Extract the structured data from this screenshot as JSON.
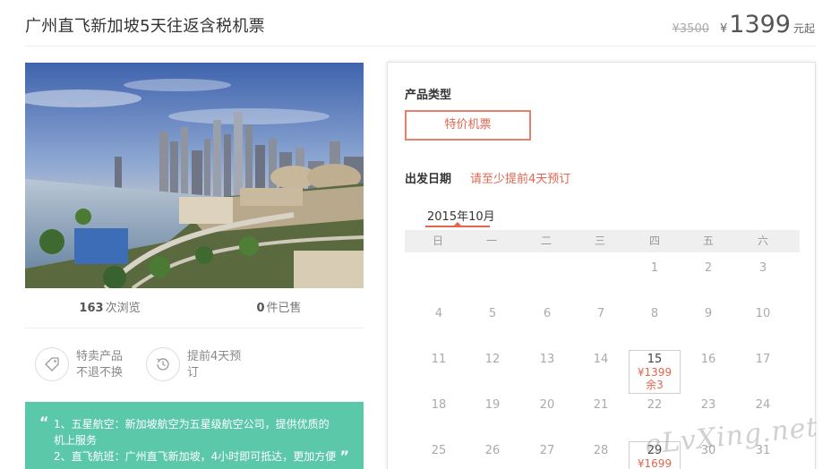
{
  "title": "广州直飞新加坡5天往返含税机票",
  "price": {
    "original": "¥3500",
    "currency": "¥",
    "current": "1399",
    "suffix": "元起"
  },
  "stats": {
    "views_count": "163",
    "views_label": "次浏览",
    "sold_count": "0",
    "sold_label": "件已售"
  },
  "features": [
    {
      "line1": "特卖产品",
      "line2": "不退不换",
      "icon": "price-tag-icon"
    },
    {
      "line1": "提前4天预",
      "line2": "订",
      "icon": "clock-icon"
    }
  ],
  "description": {
    "line1": "1、五星航空：新加坡航空为五星级航空公司，提供优质的",
    "line2": "机上服务",
    "line3": "2、直飞航班：广州直飞新加坡，4小时即可抵达，更加方便"
  },
  "booking": {
    "type_label": "产品类型",
    "type_option": "特价机票",
    "date_label": "出发日期",
    "date_note": "请至少提前4天预订",
    "month": "2015年10月",
    "weekdays": [
      "日",
      "一",
      "二",
      "三",
      "四",
      "五",
      "六"
    ],
    "days": {
      "d1": "1",
      "d2": "2",
      "d3": "3",
      "d4": "4",
      "d5": "5",
      "d6": "6",
      "d7": "7",
      "d8": "8",
      "d9": "9",
      "d10": "10",
      "d11": "11",
      "d12": "12",
      "d13": "13",
      "d14": "14",
      "d16": "16",
      "d17": "17",
      "d18": "18",
      "d19": "19",
      "d20": "20",
      "d21": "21",
      "d22": "22",
      "d23": "23",
      "d24": "24",
      "d25": "25",
      "d26": "26",
      "d27": "27",
      "d28": "28",
      "d30": "30",
      "d31": "31"
    },
    "available": [
      {
        "day": "15",
        "price": "¥1399",
        "remain": "余3"
      },
      {
        "day": "29",
        "price": "¥1699"
      }
    ]
  },
  "watermark": "eLvXing.net",
  "colors": {
    "accent": "#e0664f",
    "quote_bg": "#5bc8a9",
    "weekday_bg": "#efefef"
  }
}
